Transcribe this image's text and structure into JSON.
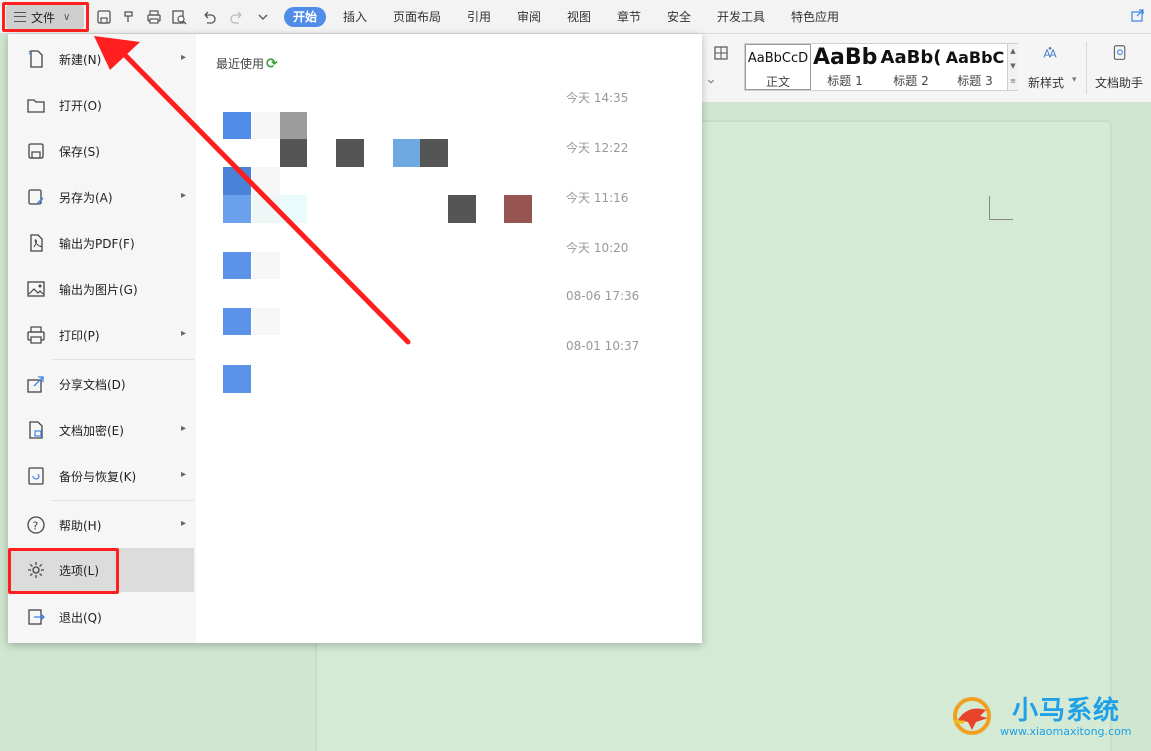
{
  "toolbar": {
    "file_label": "文件",
    "tabs": [
      "开始",
      "插入",
      "页面布局",
      "引用",
      "审阅",
      "视图",
      "章节",
      "安全",
      "开发工具",
      "特色应用"
    ],
    "active_tab": "开始"
  },
  "ribbon": {
    "styles": [
      {
        "sample": "AaBbCcD",
        "name": "正文"
      },
      {
        "sample": "AaBb",
        "name": "标题 1"
      },
      {
        "sample": "AaBb(",
        "name": "标题 2"
      },
      {
        "sample": "AaBbC",
        "name": "标题 3"
      }
    ],
    "new_style_label": "新样式",
    "doc_helper_label": "文档助手"
  },
  "file_menu": {
    "items": [
      {
        "label": "新建(N)",
        "icon": "new-doc-icon",
        "submenu": true
      },
      {
        "label": "打开(O)",
        "icon": "folder-icon",
        "submenu": false
      },
      {
        "label": "保存(S)",
        "icon": "save-icon",
        "submenu": false
      },
      {
        "label": "另存为(A)",
        "icon": "save-as-icon",
        "submenu": true
      },
      {
        "label": "输出为PDF(F)",
        "icon": "pdf-icon",
        "submenu": false
      },
      {
        "label": "输出为图片(G)",
        "icon": "image-icon",
        "submenu": false
      },
      {
        "label": "打印(P)",
        "icon": "print-icon",
        "submenu": true
      },
      {
        "label": "分享文档(D)",
        "icon": "share-icon",
        "submenu": false
      },
      {
        "label": "文档加密(E)",
        "icon": "lock-doc-icon",
        "submenu": true
      },
      {
        "label": "备份与恢复(K)",
        "icon": "backup-icon",
        "submenu": true
      },
      {
        "label": "帮助(H)",
        "icon": "help-icon",
        "submenu": true
      },
      {
        "label": "选项(L)",
        "icon": "gear-icon",
        "submenu": false
      },
      {
        "label": "退出(Q)",
        "icon": "exit-icon",
        "submenu": false
      }
    ],
    "selected_item": "选项(L)",
    "recent": {
      "title": "最近使用",
      "times": [
        "今天 14:35",
        "今天 12:22",
        "今天 11:16",
        "今天 10:20",
        "08-06 17:36",
        "08-01 10:37"
      ]
    }
  },
  "watermark": {
    "title": "小马系统",
    "url": "www.xiaomaxitong.com"
  },
  "colors": {
    "accent": "#4f8de8",
    "highlight": "#ff1f1f",
    "background": "#cfe6cf"
  }
}
